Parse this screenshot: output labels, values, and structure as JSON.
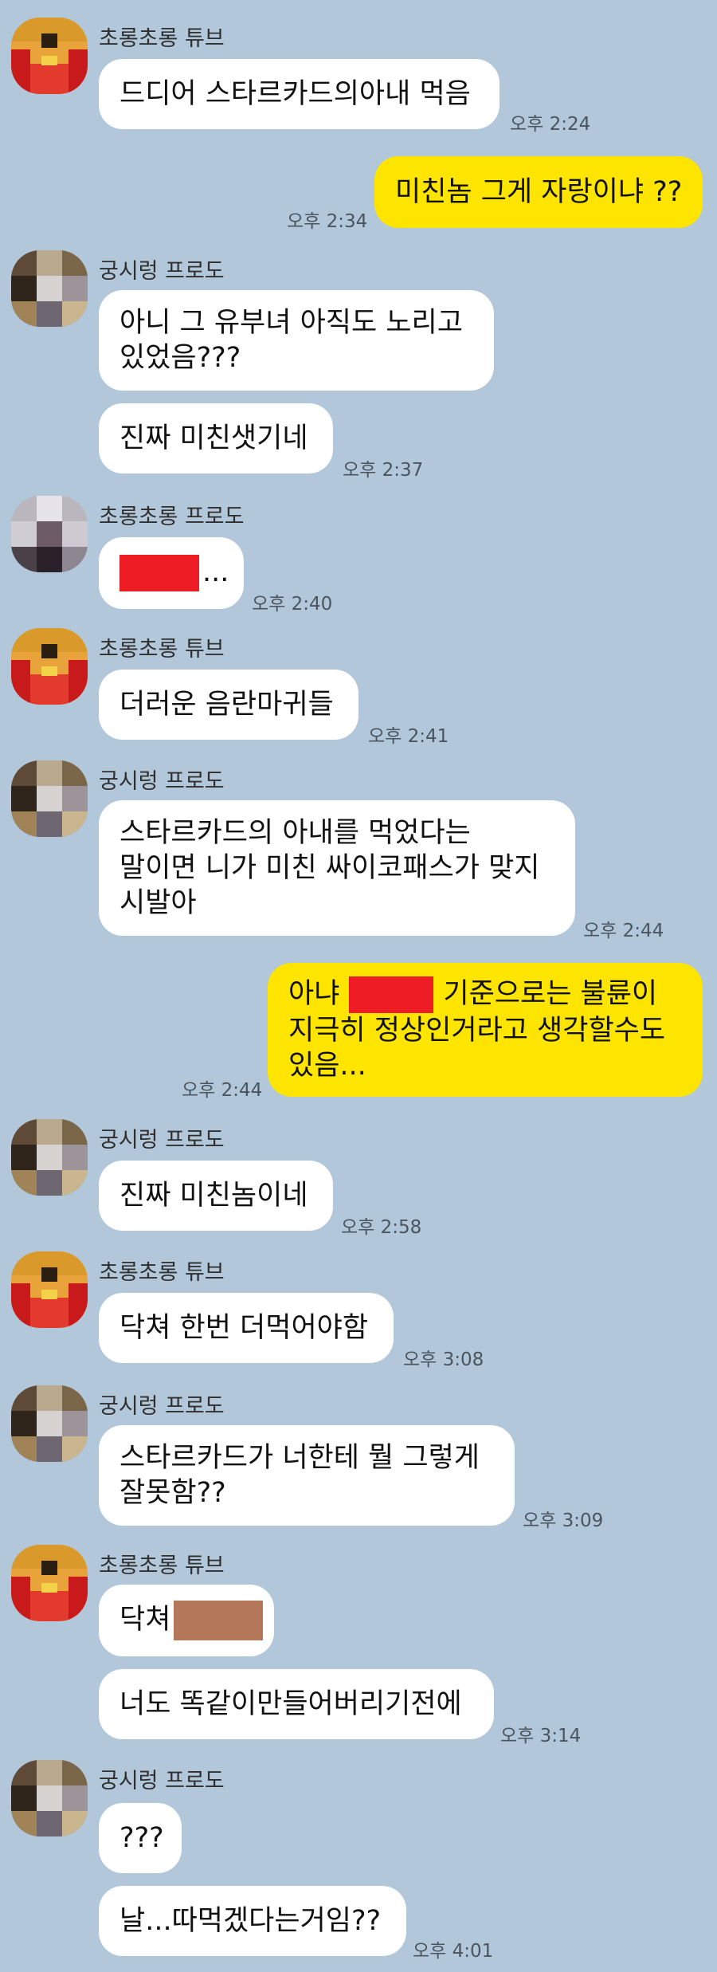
{
  "messages": [
    {
      "sender": "초롱초롱 튜브",
      "lines": [
        "드디어 스타르카드의아내 먹음"
      ],
      "time": "오후 2:24"
    },
    {
      "sender": "me",
      "lines": [
        "미친놈 그게 자랑이냐 ??"
      ],
      "time": "오후 2:34"
    },
    {
      "sender": "궁시렁 프로도",
      "lines": [
        "아니 그 유부녀 아직도 노리고",
        "있었음???"
      ]
    },
    {
      "sender": "궁시렁 프로도",
      "lines": [
        "진짜 미친샛기네"
      ],
      "time": "오후 2:37"
    },
    {
      "sender": "초롱초롱 프로도",
      "lines": [
        "..."
      ],
      "time": "오후 2:40"
    },
    {
      "sender": "초롱초롱 튜브",
      "lines": [
        "더러운 음란마귀들"
      ],
      "time": "오후 2:41"
    },
    {
      "sender": "궁시렁 프로도",
      "lines": [
        "스타르카드의 아내를 먹었다는",
        "말이면 니가 미친 싸이코패스가 맞지",
        "시발아"
      ],
      "time": "오후 2:44"
    },
    {
      "sender": "me",
      "lines": [
        "아냐",
        "기준으로는 불륜이",
        "지극히 정상인거라고 생각할수도",
        "있음..."
      ],
      "time": "오후 2:44"
    },
    {
      "sender": "궁시렁 프로도",
      "lines": [
        "진짜 미친놈이네"
      ],
      "time": "오후 2:58"
    },
    {
      "sender": "초롱초롱 튜브",
      "lines": [
        "닥쳐 한번 더먹어야함"
      ],
      "time": "오후 3:08"
    },
    {
      "sender": "궁시렁 프로도",
      "lines": [
        "스타르카드가 너한테 뭘 그렇게",
        "잘못함??"
      ],
      "time": "오후 3:09"
    },
    {
      "sender": "초롱초롱 튜브",
      "lines": [
        "닥쳐"
      ]
    },
    {
      "sender": "초롱초롱 튜브",
      "lines": [
        "너도 똑같이만들어버리기전에"
      ],
      "time": "오후 3:14"
    },
    {
      "sender": "궁시렁 프로도",
      "lines": [
        "???"
      ]
    },
    {
      "sender": "궁시렁 프로도",
      "lines": [
        "날...따먹겠다는거임??"
      ],
      "time": "오후 4:01"
    }
  ],
  "colors": {
    "background": "#b2c7d9",
    "my_bubble": "#fee500",
    "their_bubble": "#ffffff",
    "redaction_red": "#ee1c25",
    "redaction_brown": "#b5775a"
  }
}
